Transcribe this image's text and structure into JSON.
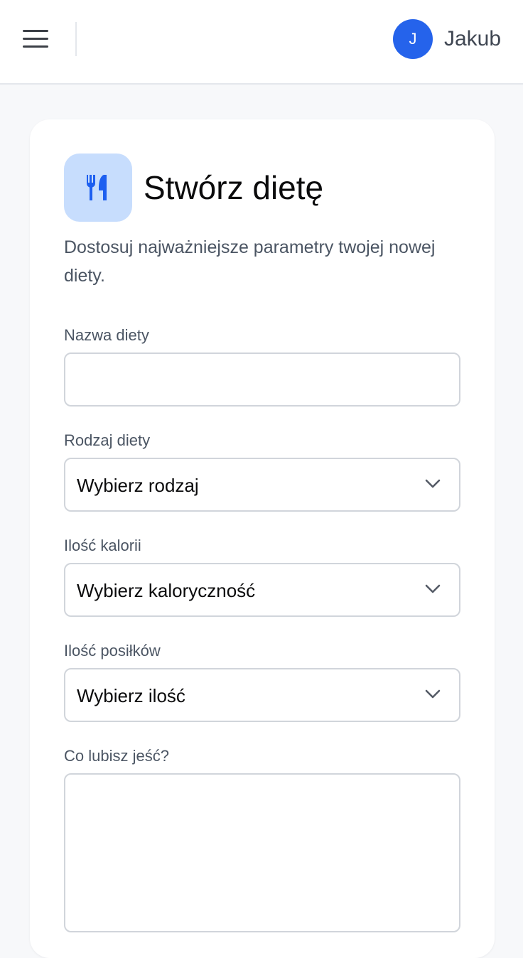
{
  "header": {
    "avatar_initial": "J",
    "username": "Jakub"
  },
  "form": {
    "title": "Stwórz dietę",
    "subtitle": "Dostosuj najważniejsze parametry twojej nowej diety.",
    "icon": "utensils-icon",
    "fields": {
      "name": {
        "label": "Nazwa diety",
        "value": ""
      },
      "type": {
        "label": "Rodzaj diety",
        "selected": "Wybierz rodzaj"
      },
      "calories": {
        "label": "Ilość kalorii",
        "selected": "Wybierz kaloryczność"
      },
      "meals": {
        "label": "Ilość posiłków",
        "selected": "Wybierz ilość"
      },
      "likes": {
        "label": "Co lubisz jeść?",
        "value": ""
      }
    }
  },
  "colors": {
    "accent": "#2563eb",
    "icon_tile": "#c7ddfd",
    "border": "#d1d5db",
    "background": "#f7f8fa"
  }
}
